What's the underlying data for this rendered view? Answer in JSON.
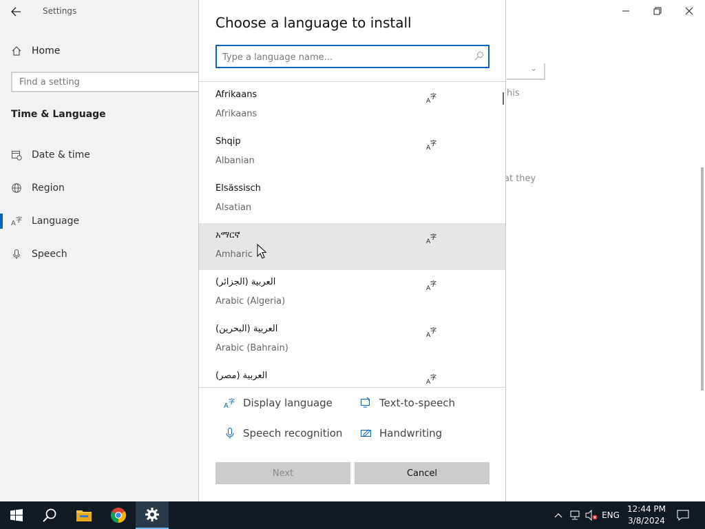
{
  "settings": {
    "window_title": "Settings",
    "home_label": "Home",
    "search_placeholder": "Find a setting",
    "section_title": "Time & Language",
    "nav": [
      {
        "label": "Date & time",
        "icon": "calendar-clock-icon"
      },
      {
        "label": "Region",
        "icon": "globe-icon"
      },
      {
        "label": "Language",
        "icon": "language-icon"
      },
      {
        "label": "Speech",
        "icon": "microphone-icon"
      }
    ],
    "active_nav": "Language",
    "right_text_1": "his",
    "right_text_2": "at they"
  },
  "dialog": {
    "title": "Choose a language to install",
    "search_placeholder": "Type a language name...",
    "languages": [
      {
        "native": "Afrikaans",
        "english": "Afrikaans",
        "display_language": true
      },
      {
        "native": "Shqip",
        "english": "Albanian",
        "display_language": true
      },
      {
        "native": "Elsässisch",
        "english": "Alsatian",
        "display_language": false
      },
      {
        "native": "አማርኛ",
        "english": "Amharic",
        "display_language": true,
        "hovered": true
      },
      {
        "native": "العربية (الجزائر)",
        "english": "Arabic (Algeria)",
        "display_language": true
      },
      {
        "native": "العربية (البحرين)",
        "english": "Arabic (Bahrain)",
        "display_language": true
      },
      {
        "native": "العربية (مصر)",
        "english": "",
        "display_language": true
      }
    ],
    "legend": {
      "display_language": "Display language",
      "text_to_speech": "Text-to-speech",
      "speech_recognition": "Speech recognition",
      "handwriting": "Handwriting"
    },
    "next_label": "Next",
    "cancel_label": "Cancel"
  },
  "taskbar": {
    "apps": [
      "windows-start-icon",
      "search-icon",
      "file-explorer-icon",
      "chrome-icon",
      "settings-gear-icon"
    ],
    "input_language": "ENG",
    "time": "12:44 PM",
    "date": "3/8/2024"
  },
  "colors": {
    "accent": "#0a63b8",
    "taskbar": "#101a23",
    "sidebar": "#f2f2f2",
    "hover_row": "#e6e6e6",
    "button": "#cccccc"
  }
}
